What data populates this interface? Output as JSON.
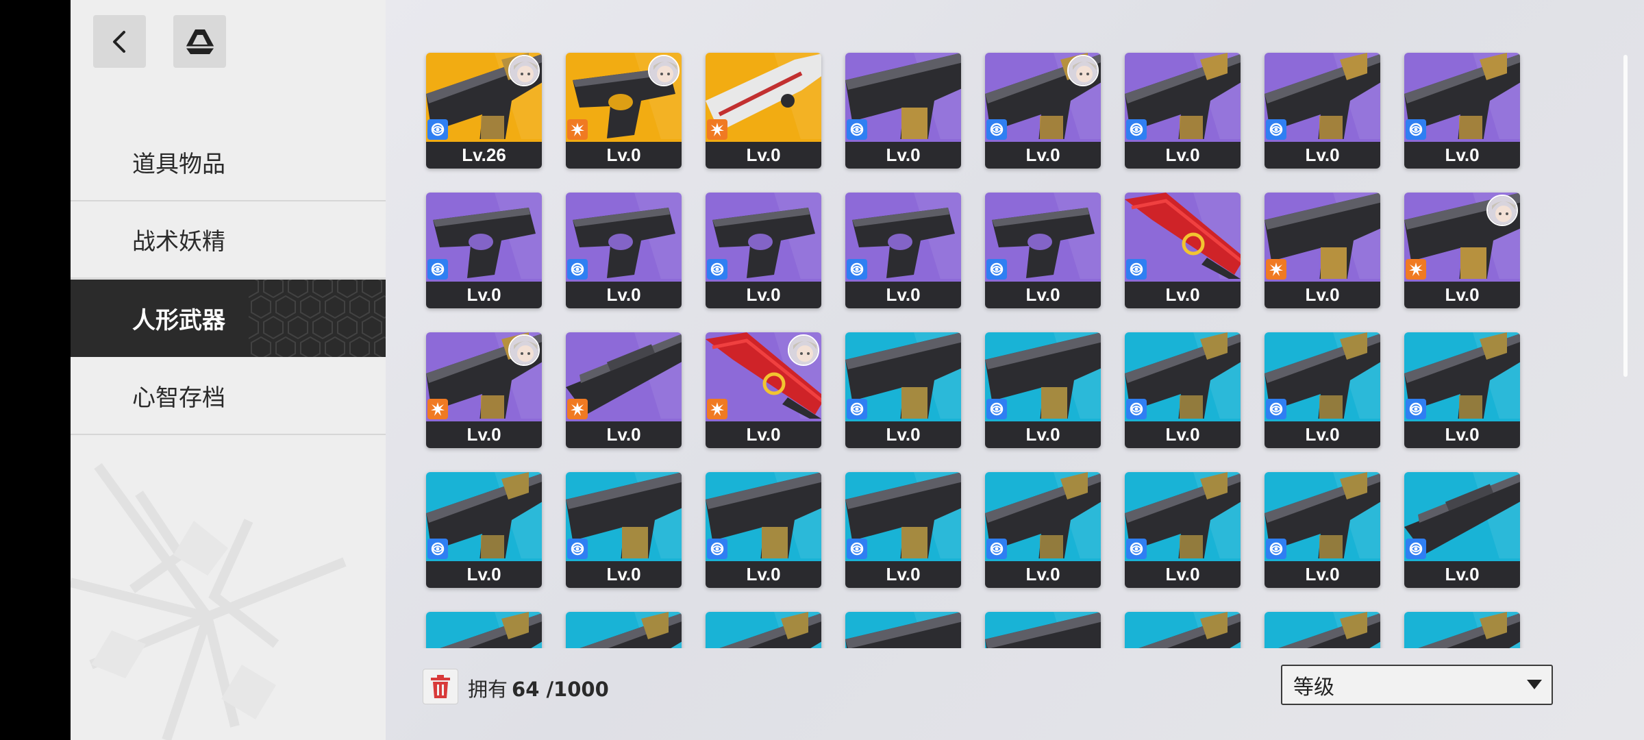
{
  "sidebar": {
    "items": [
      {
        "label": "道具物品",
        "active": false
      },
      {
        "label": "战术妖精",
        "active": false
      },
      {
        "label": "人形武器",
        "active": true
      },
      {
        "label": "心智存档",
        "active": false
      }
    ]
  },
  "colors": {
    "gold": "#f2ac12",
    "purple": "#8d6ad8",
    "cyan": "#19b3d6",
    "badge_blue": "#2f7ff2",
    "badge_orange": "#f07a22"
  },
  "inventory": {
    "rows": [
      [
        {
          "rarity": "gold",
          "badge": "blue",
          "level": "Lv.26",
          "avatar": true,
          "weapon": "rifle-icon"
        },
        {
          "rarity": "gold",
          "badge": "orange",
          "level": "Lv.0",
          "avatar": true,
          "weapon": "pistol-icon"
        },
        {
          "rarity": "gold",
          "badge": "orange",
          "level": "Lv.0",
          "avatar": false,
          "weapon": "shotgun-icon"
        },
        {
          "rarity": "purple",
          "badge": "blue",
          "level": "Lv.0",
          "avatar": false,
          "weapon": "smg-icon"
        },
        {
          "rarity": "purple",
          "badge": "blue",
          "level": "Lv.0",
          "avatar": true,
          "weapon": "rifle-icon"
        },
        {
          "rarity": "purple",
          "badge": "blue",
          "level": "Lv.0",
          "avatar": false,
          "weapon": "rifle-icon"
        },
        {
          "rarity": "purple",
          "badge": "blue",
          "level": "Lv.0",
          "avatar": false,
          "weapon": "rifle-icon"
        },
        {
          "rarity": "purple",
          "badge": "blue",
          "level": "Lv.0",
          "avatar": false,
          "weapon": "rifle-icon"
        }
      ],
      [
        {
          "rarity": "purple",
          "badge": "blue",
          "level": "Lv.0",
          "avatar": false,
          "weapon": "pistol-icon"
        },
        {
          "rarity": "purple",
          "badge": "blue",
          "level": "Lv.0",
          "avatar": false,
          "weapon": "pistol-icon"
        },
        {
          "rarity": "purple",
          "badge": "blue",
          "level": "Lv.0",
          "avatar": false,
          "weapon": "pistol-icon"
        },
        {
          "rarity": "purple",
          "badge": "blue",
          "level": "Lv.0",
          "avatar": false,
          "weapon": "pistol-icon"
        },
        {
          "rarity": "purple",
          "badge": "blue",
          "level": "Lv.0",
          "avatar": false,
          "weapon": "pistol-icon"
        },
        {
          "rarity": "purple",
          "badge": "blue",
          "level": "Lv.0",
          "avatar": false,
          "weapon": "red-shotgun-icon"
        },
        {
          "rarity": "purple",
          "badge": "orange",
          "level": "Lv.0",
          "avatar": false,
          "weapon": "smg-icon"
        },
        {
          "rarity": "purple",
          "badge": "orange",
          "level": "Lv.0",
          "avatar": true,
          "weapon": "smg-icon"
        }
      ],
      [
        {
          "rarity": "purple",
          "badge": "orange",
          "level": "Lv.0",
          "avatar": true,
          "weapon": "rifle-icon"
        },
        {
          "rarity": "purple",
          "badge": "orange",
          "level": "Lv.0",
          "avatar": false,
          "weapon": "sniper-icon"
        },
        {
          "rarity": "purple",
          "badge": "orange",
          "level": "Lv.0",
          "avatar": true,
          "weapon": "red-shotgun-icon"
        },
        {
          "rarity": "cyan",
          "badge": "blue",
          "level": "Lv.0",
          "avatar": false,
          "weapon": "smg-icon"
        },
        {
          "rarity": "cyan",
          "badge": "blue",
          "level": "Lv.0",
          "avatar": false,
          "weapon": "smg-icon"
        },
        {
          "rarity": "cyan",
          "badge": "blue",
          "level": "Lv.0",
          "avatar": false,
          "weapon": "rifle-icon"
        },
        {
          "rarity": "cyan",
          "badge": "blue",
          "level": "Lv.0",
          "avatar": false,
          "weapon": "rifle-icon"
        },
        {
          "rarity": "cyan",
          "badge": "blue",
          "level": "Lv.0",
          "avatar": false,
          "weapon": "rifle-icon"
        }
      ],
      [
        {
          "rarity": "cyan",
          "badge": "blue",
          "level": "Lv.0",
          "avatar": false,
          "weapon": "rifle-icon"
        },
        {
          "rarity": "cyan",
          "badge": "blue",
          "level": "Lv.0",
          "avatar": false,
          "weapon": "smg-icon"
        },
        {
          "rarity": "cyan",
          "badge": "blue",
          "level": "Lv.0",
          "avatar": false,
          "weapon": "smg-icon"
        },
        {
          "rarity": "cyan",
          "badge": "blue",
          "level": "Lv.0",
          "avatar": false,
          "weapon": "smg-icon"
        },
        {
          "rarity": "cyan",
          "badge": "blue",
          "level": "Lv.0",
          "avatar": false,
          "weapon": "rifle-icon"
        },
        {
          "rarity": "cyan",
          "badge": "blue",
          "level": "Lv.0",
          "avatar": false,
          "weapon": "rifle-icon"
        },
        {
          "rarity": "cyan",
          "badge": "blue",
          "level": "Lv.0",
          "avatar": false,
          "weapon": "rifle-icon"
        },
        {
          "rarity": "cyan",
          "badge": "blue",
          "level": "Lv.0",
          "avatar": false,
          "weapon": "sniper-icon"
        }
      ],
      [
        {
          "rarity": "cyan",
          "partial": true,
          "weapon": "rifle-icon"
        },
        {
          "rarity": "cyan",
          "partial": true,
          "weapon": "rifle-icon"
        },
        {
          "rarity": "cyan",
          "partial": true,
          "weapon": "rifle-icon"
        },
        {
          "rarity": "cyan",
          "partial": true,
          "weapon": "smg-icon"
        },
        {
          "rarity": "cyan",
          "partial": true,
          "weapon": "smg-icon"
        },
        {
          "rarity": "cyan",
          "partial": true,
          "weapon": "rifle-icon"
        },
        {
          "rarity": "cyan",
          "partial": true,
          "weapon": "rifle-icon"
        },
        {
          "rarity": "cyan",
          "partial": true,
          "weapon": "rifle-icon"
        }
      ]
    ]
  },
  "footer": {
    "owned_label": "拥有",
    "owned_count": "64 /1000",
    "sort_value": "等级"
  }
}
